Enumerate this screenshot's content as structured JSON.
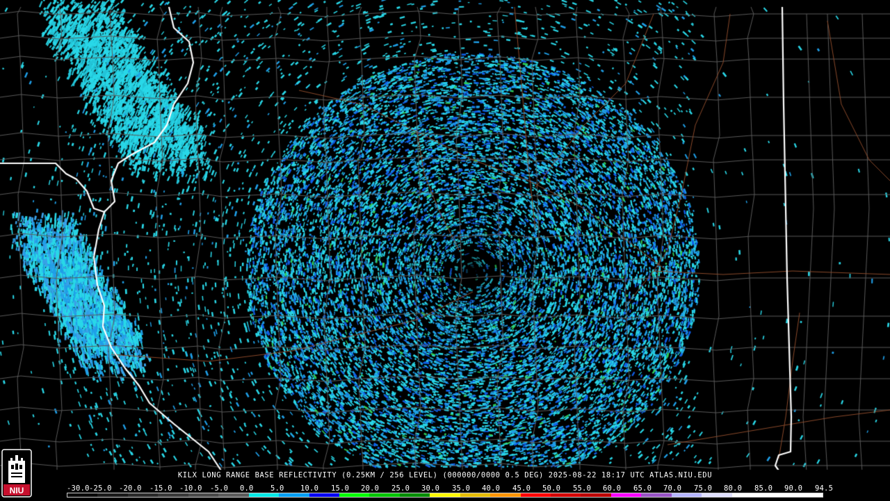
{
  "caption": "KILX LONG RANGE BASE REFLECTIVITY (0.25KM / 256 LEVEL) (000000/0000 0.5 DEG) 2025-08-22 18:17 UTC  ATLAS.NIU.EDU",
  "logo": {
    "text": "NIU",
    "icon": "castle-tower-icon",
    "color": "#c8102e"
  },
  "legend": {
    "labels": [
      "-30.0",
      "-25.0",
      "-20.0",
      "-15.0",
      "-10.0",
      "-5.0",
      "0.0",
      "5.0",
      "10.0",
      "15.0",
      "20.0",
      "25.0",
      "30.0",
      "35.0",
      "40.0",
      "45.0",
      "50.0",
      "55.0",
      "60.0",
      "65.0",
      "70.0",
      "75.0",
      "80.0",
      "85.0",
      "90.0",
      "94.5"
    ],
    "colors": [
      "#0a0a0a",
      "#1a1a1a",
      "#2a2a2a",
      "#3a3a3a",
      "#4a4a4a",
      "#5c5c5c",
      "#04e9e7",
      "#019ff4",
      "#0300f4",
      "#02fd02",
      "#01c501",
      "#008e00",
      "#fdf802",
      "#e5bc00",
      "#fd9500",
      "#fd0000",
      "#d40000",
      "#bc0000",
      "#f800fd",
      "#9854c6",
      "#b6b6ff",
      "#e0e0ff",
      "#ffffff",
      "#ffffff",
      "#ffffff"
    ]
  },
  "colors": {
    "echo_primary": "#29d8e8",
    "echo_secondary": "#1f9fe8",
    "echo_strong": "#1060e8",
    "echo_green": "#2fcf5a",
    "county_lines": "#5a5a5a",
    "state_lines": "#ffffff",
    "highways": "#8b4a2b"
  }
}
